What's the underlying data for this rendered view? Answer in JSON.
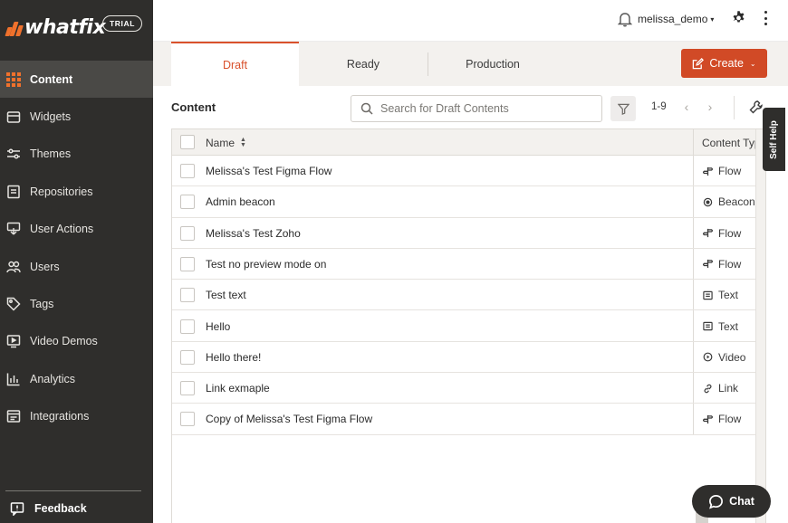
{
  "brand": {
    "logo_text": "whatfix",
    "badge": "TRIAL"
  },
  "header": {
    "username": "melissa_demo",
    "username_caret": "▾"
  },
  "sidebar": {
    "items": [
      {
        "label": "Content",
        "icon": "grid-icon",
        "active": true
      },
      {
        "label": "Widgets",
        "icon": "widgets-icon",
        "active": false
      },
      {
        "label": "Themes",
        "icon": "sliders-icon",
        "active": false
      },
      {
        "label": "Repositories",
        "icon": "repository-icon",
        "active": false
      },
      {
        "label": "User Actions",
        "icon": "user-actions-icon",
        "active": false
      },
      {
        "label": "Users",
        "icon": "users-icon",
        "active": false
      },
      {
        "label": "Tags",
        "icon": "tag-icon",
        "active": false
      },
      {
        "label": "Video Demos",
        "icon": "video-icon",
        "active": false
      },
      {
        "label": "Analytics",
        "icon": "analytics-icon",
        "active": false
      },
      {
        "label": "Integrations",
        "icon": "integrations-icon",
        "active": false
      }
    ],
    "feedback_label": "Feedback"
  },
  "tabs": [
    {
      "label": "Draft",
      "active": true
    },
    {
      "label": "Ready",
      "active": false
    },
    {
      "label": "Production",
      "active": false
    }
  ],
  "create_button": {
    "label": "Create",
    "caret": "⌄"
  },
  "content": {
    "title": "Content",
    "search_placeholder": "Search for Draft Contents",
    "pagination": "1-9",
    "prev_glyph": "‹",
    "next_glyph": "›"
  },
  "table": {
    "columns": {
      "name": "Name",
      "type": "Content Type"
    },
    "rows": [
      {
        "name": "Melissa's Test Figma Flow",
        "type": "Flow",
        "icon": "flow-icon"
      },
      {
        "name": "Admin beacon",
        "type": "Beacon",
        "icon": "beacon-icon"
      },
      {
        "name": "Melissa's Test Zoho",
        "type": "Flow",
        "icon": "flow-icon"
      },
      {
        "name": "Test no preview mode on",
        "type": "Flow",
        "icon": "flow-icon"
      },
      {
        "name": "Test text",
        "type": "Text",
        "icon": "text-icon"
      },
      {
        "name": "Hello",
        "type": "Text",
        "icon": "text-icon"
      },
      {
        "name": "Hello there!",
        "type": "Video",
        "icon": "video-play-icon"
      },
      {
        "name": "Link exmaple",
        "type": "Link",
        "icon": "link-icon"
      },
      {
        "name": "Copy of Melissa's Test Figma Flow",
        "type": "Flow",
        "icon": "flow-icon"
      }
    ]
  },
  "self_help": {
    "label": "Self Help"
  },
  "chat": {
    "label": "Chat"
  },
  "colors": {
    "brand_orange": "#f0712c",
    "accent_red": "#d14a26",
    "sidebar_bg": "#2f2e2c",
    "sidebar_active": "#4a4946"
  }
}
